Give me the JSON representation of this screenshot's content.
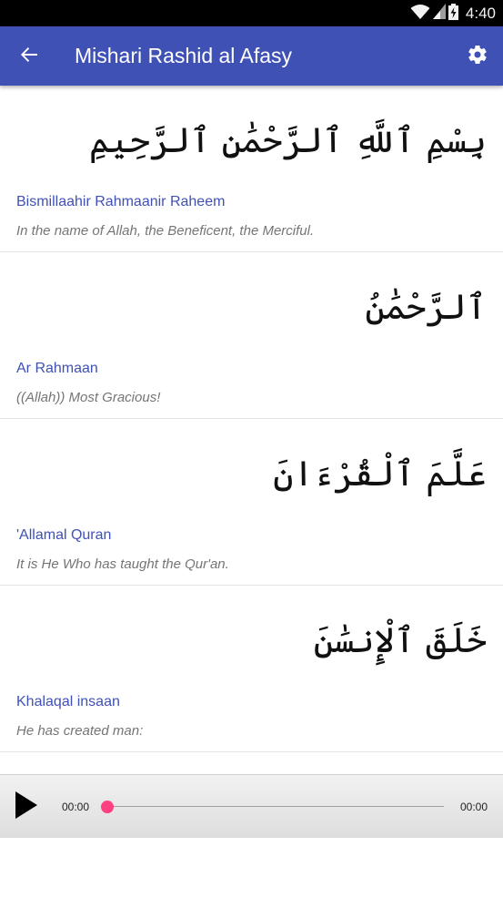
{
  "status_bar": {
    "time": "4:40",
    "icons": [
      "wifi-icon",
      "signal-icon",
      "battery-charging-icon"
    ]
  },
  "app_bar": {
    "title": "Mishari Rashid al Afasy",
    "back_icon": "arrow-back-icon",
    "settings_icon": "gear-icon"
  },
  "verses": [
    {
      "arabic": "بِسْمِ ٱللَّهِ ٱلرَّحْمَٰنِ ٱلرَّحِيمِ",
      "transliteration": "Bismillaahir Rahmaanir Raheem",
      "translation": "In the name of Allah, the Beneficent, the Merciful."
    },
    {
      "arabic": "ٱلرَّحْمَٰنُ",
      "transliteration": "Ar Rahmaan",
      "translation": "((Allah)) Most Gracious!"
    },
    {
      "arabic": "عَلَّمَ ٱلْقُرْءَانَ",
      "transliteration": "'Allamal Quran",
      "translation": "It is He Who has taught the Qur'an."
    },
    {
      "arabic": "خَلَقَ ٱلْإِنسَٰنَ",
      "transliteration": "Khalaqal insaan",
      "translation": "He has created man:"
    }
  ],
  "player": {
    "elapsed": "00:00",
    "total": "00:00",
    "progress": 0,
    "play_icon": "play-icon",
    "accent_color": "#ff4081"
  },
  "colors": {
    "primary": "#3f51b5",
    "accent": "#ff4081"
  }
}
